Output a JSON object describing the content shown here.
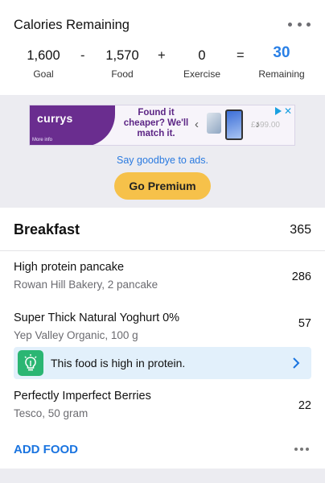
{
  "summary": {
    "title": "Calories Remaining",
    "goal": {
      "value": "1,600",
      "label": "Goal"
    },
    "op_minus": "-",
    "food": {
      "value": "1,570",
      "label": "Food"
    },
    "op_plus": "+",
    "exercise": {
      "value": "0",
      "label": "Exercise"
    },
    "op_equals": "=",
    "remaining": {
      "value": "30",
      "label": "Remaining"
    }
  },
  "ad": {
    "logo": "currys",
    "more_info": "More info",
    "headline": "Found it cheaper? We'll match it.",
    "price": "£499.00",
    "say_goodbye": "Say goodbye to ads.",
    "premium_button": "Go Premium"
  },
  "meal": {
    "title": "Breakfast",
    "total": "365",
    "items": [
      {
        "name": "High protein pancake",
        "desc": "Rowan Hill Bakery, 2 pancake",
        "cal": "286"
      },
      {
        "name": "Super Thick Natural Yoghurt 0%",
        "desc": "Yep Valley Organic, 100 g",
        "cal": "57"
      },
      {
        "name": "Perfectly Imperfect Berries",
        "desc": "Tesco, 50 gram",
        "cal": "22"
      }
    ],
    "tip": "This food is high in protein.",
    "add_food": "ADD FOOD"
  },
  "colors": {
    "accent_blue": "#2a80e6",
    "premium_yellow": "#f6c14a",
    "tip_green": "#2bb673",
    "tip_bg": "#e2f0fb"
  }
}
